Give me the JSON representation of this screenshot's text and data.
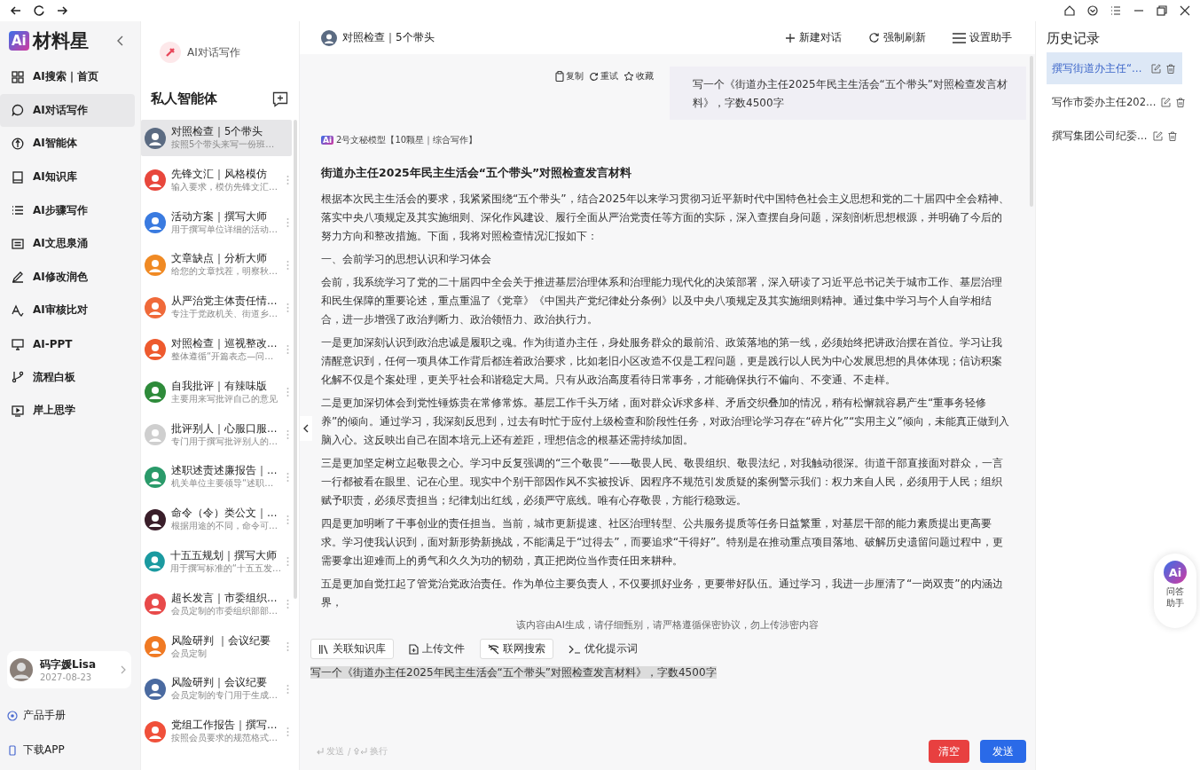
{
  "logo": {
    "badge": "Ai",
    "name": "材料星"
  },
  "nav": [
    {
      "label": "AI搜索｜首页",
      "selected": false
    },
    {
      "label": "AI对话写作",
      "selected": true
    },
    {
      "label": "AI智能体",
      "selected": false
    },
    {
      "label": "AI知识库",
      "selected": false
    },
    {
      "label": "AI步骤写作",
      "selected": false
    },
    {
      "label": "AI文思泉涌",
      "selected": false
    },
    {
      "label": "AI修改润色",
      "selected": false
    },
    {
      "label": "AI审核比对",
      "selected": false
    },
    {
      "label": "AI-PPT",
      "selected": false
    },
    {
      "label": "流程白板",
      "selected": false
    },
    {
      "label": "岸上思学",
      "selected": false
    }
  ],
  "user": {
    "name": "码字媛Lisa",
    "date": "2027-08-23"
  },
  "footer_links": [
    "产品手册",
    "下载APP"
  ],
  "agents_panel": {
    "mode": "AI对话写作",
    "heading": "私人智能体",
    "agents": [
      {
        "title": "对照检查｜5个带头",
        "subtitle": "按照5个带头来写一份班…",
        "color": "#5b6b82",
        "selected": true
      },
      {
        "title": "先锋文汇｜风格模仿",
        "subtitle": "输入要求，模仿先锋文汇…",
        "color": "#e8473c",
        "selected": false
      },
      {
        "title": "活动方案｜撰写大师",
        "subtitle": "用于撰写单位详细的活动…",
        "color": "#3a7be0",
        "selected": false
      },
      {
        "title": "文章缺点｜分析大师",
        "subtitle": "给您的文章找茬，明察秋…",
        "color": "#f08a24",
        "selected": false
      },
      {
        "title": "从严治党主体责任情…",
        "subtitle": "专注于党政机关、街道乡…",
        "color": "#f06a3a",
        "selected": false
      },
      {
        "title": "对照检查｜巡视整改…",
        "subtitle": "整体遵循“开篇表态—问…",
        "color": "#ee5a2e",
        "selected": false
      },
      {
        "title": "自我批评｜有辣味版",
        "subtitle": "主要用来写批评自己的意见",
        "color": "#2e8b3a",
        "selected": false
      },
      {
        "title": "批评别人｜心服口服…",
        "subtitle": "专门用于撰写批评别人的…",
        "color": "#cfcfcf",
        "selected": false
      },
      {
        "title": "述职述责述廉报告｜…",
        "subtitle": "机关单位主要领导“述职…",
        "color": "#2a9a6a",
        "selected": false
      },
      {
        "title": "命令（令）类公文｜…",
        "subtitle": "根据用途的不同，命令可…",
        "color": "#3a1e2a",
        "selected": false
      },
      {
        "title": "十五五规划｜撰写大师",
        "subtitle": "用于撰写标准的“十五五发…",
        "color": "#1a9aa0",
        "selected": false
      },
      {
        "title": "超长发言｜市委组织…",
        "subtitle": "会员定制的市委组织部部…",
        "color": "#e84a4a",
        "selected": false
      },
      {
        "title": "风险研判 ｜会议纪要",
        "subtitle": "会员定制",
        "color": "#f07a24",
        "selected": false
      },
      {
        "title": "风险研判｜会议纪要",
        "subtitle": "会员定制的专门用于生成…",
        "color": "#4a6aa0",
        "selected": false
      },
      {
        "title": "党组工作报告｜撰写…",
        "subtitle": "按照会员要求的规范格式…",
        "color": "#f0503a",
        "selected": false
      }
    ]
  },
  "chat": {
    "title": "对照检查｜5个带头",
    "actions": [
      "新建对话",
      "强制刷新",
      "设置助手"
    ],
    "user_message": {
      "tools": [
        "复制",
        "重试",
        "收藏"
      ],
      "text": "写一个《街道办主任2025年民主生活会“五个带头”对照检查发言材料》，字数4500字"
    },
    "model": {
      "badge": "Ai",
      "label": "2号文秘模型【10颗星｜综合写作】"
    },
    "answer": {
      "title": "街道办主任2025年民主生活会“五个带头”对照检查发言材料",
      "paragraphs": [
        "根据本次民主生活会的要求，我紧紧围绕“五个带头”，结合2025年以来学习贯彻习近平新时代中国特色社会主义思想和党的二十届四中全会精神、落实中央八项规定及其实施细则、深化作风建设、履行全面从严治党责任等方面的实际，深入查摆自身问题，深刻剖析思想根源，并明确了今后的努力方向和整改措施。下面，我将对照检查情况汇报如下：",
        "一、会前学习的思想认识和学习体会",
        "会前，我系统学习了党的二十届四中全会关于推进基层治理体系和治理能力现代化的决策部署，深入研读了习近平总书记关于城市工作、基层治理和民生保障的重要论述，重点重温了《党章》《中国共产党纪律处分条例》以及中央八项规定及其实施细则精神。通过集中学习与个人自学相结合，进一步增强了政治判断力、政治领悟力、政治执行力。",
        "一是更加深刻认识到政治忠诚是履职之魂。作为街道办主任，身处服务群众的最前沿、政策落地的第一线，必须始终把讲政治摆在首位。学习让我清醒意识到，任何一项具体工作背后都连着政治要求，比如老旧小区改造不仅是工程问题，更是践行以人民为中心发展思想的具体体现；信访积案化解不仅是个案处理，更关乎社会和谐稳定大局。只有从政治高度看待日常事务，才能确保执行不偏向、不变通、不走样。",
        "二是更加深切体会到党性锤炼贵在常修常炼。基层工作千头万绪，面对群众诉求多样、矛盾交织叠加的情况，稍有松懈就容易产生“重事务轻修养”的倾向。通过学习，我深刻反思到，过去有时忙于应付上级检查和阶段性任务，对政治理论学习存在“碎片化”“实用主义”倾向，未能真正做到入脑入心。这反映出自己在固本培元上还有差距，理想信念的根基还需持续加固。",
        "三是更加坚定树立起敬畏之心。学习中反复强调的“三个敬畏”——敬畏人民、敬畏组织、敬畏法纪，对我触动很深。街道干部直接面对群众，一言一行都被看在眼里、记在心里。现实中个别干部因作风不实被投诉、因程序不规范引发质疑的案例警示我们：权力来自人民，必须用于人民；组织赋予职责，必须尽责担当；纪律划出红线，必须严守底线。唯有心存敬畏，方能行稳致远。",
        "四是更加明晰了干事创业的责任担当。当前，城市更新提速、社区治理转型、公共服务提质等任务日益繁重，对基层干部的能力素质提出更高要求。学习使我认识到，面对新形势新挑战，不能满足于“过得去”，而要追求“干得好”。特别是在推动重点项目落地、破解历史遗留问题过程中，更需要拿出迎难而上的勇气和久久为功的韧劲，真正把岗位当作责任田来耕种。",
        "五是更加自觉扛起了管党治党政治责任。作为单位主要负责人，不仅要抓好业务，更要带好队伍。通过学习，我进一步厘清了“一岗双责”的内涵边界，"
      ]
    },
    "disclaimer": "该内容由AI生成，请仔细甄别，请严格遵循保密协议，勿上传涉密内容",
    "composer": {
      "tools": [
        {
          "label": "关联知识库",
          "on": true
        },
        {
          "label": "上传文件",
          "on": false
        },
        {
          "label": "联网搜索",
          "on": true
        },
        {
          "label": "优化提示词",
          "on": false
        }
      ],
      "value": "写一个《街道办主任2025年民主生活会“五个带头”对照检查发言材料》，字数4500字",
      "hints": [
        "发送",
        "/",
        "换行"
      ],
      "buttons": [
        "清空",
        "发送"
      ]
    }
  },
  "history": {
    "heading": "历史记录",
    "items": [
      {
        "title": "撰写街道办主任“…",
        "selected": true
      },
      {
        "title": "写作市委办主任202…",
        "selected": false
      },
      {
        "title": "撰写集团公司纪委…",
        "selected": false
      }
    ]
  },
  "assistant": {
    "badge": "Ai",
    "label": "问答助手"
  }
}
